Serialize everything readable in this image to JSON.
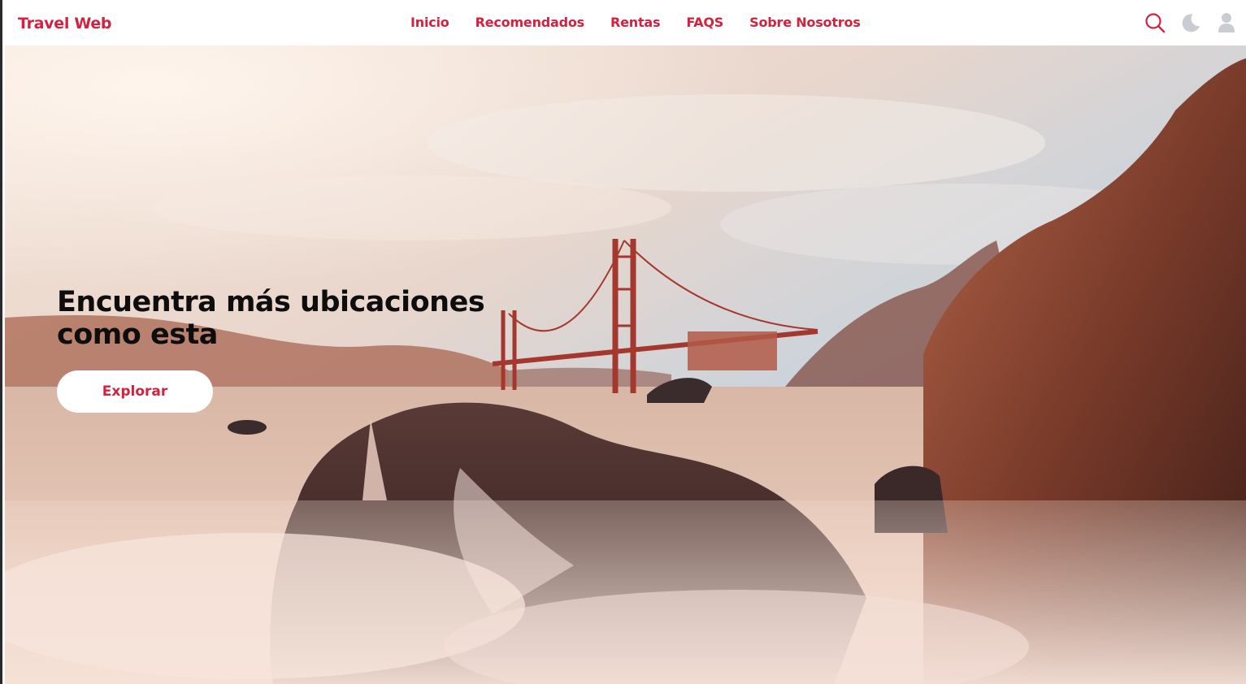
{
  "header": {
    "logo": "Travel Web",
    "nav": [
      "Inicio",
      "Recomendados",
      "Rentas",
      "FAQS",
      "Sobre Nosotros"
    ],
    "icons": [
      "search-icon",
      "moon-icon",
      "user-icon"
    ]
  },
  "hero": {
    "title": "Encuentra más ubicaciones como esta",
    "cta_label": "Explorar"
  },
  "colors": {
    "accent": "#d4213d",
    "icon_muted": "#c9ccd2",
    "title": "#0d0d0d"
  }
}
